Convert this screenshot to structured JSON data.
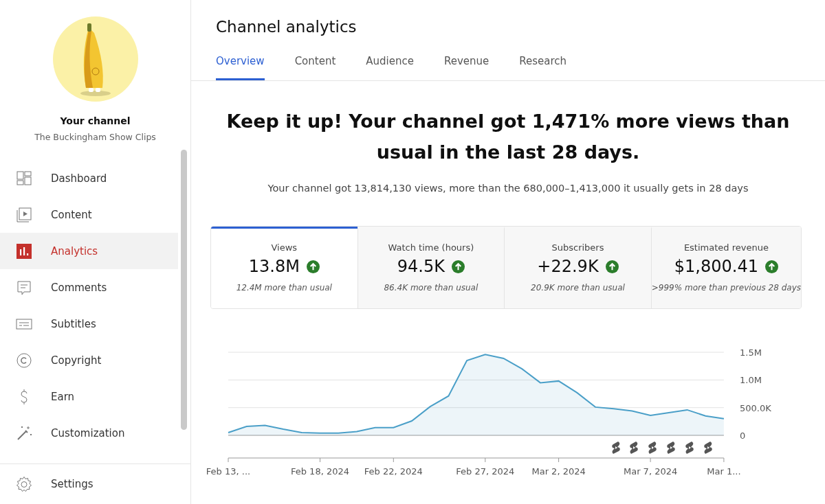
{
  "sidebar": {
    "channel_title": "Your channel",
    "channel_name": "The Buckingham Show Clips",
    "items": [
      {
        "label": "Dashboard",
        "selected": false
      },
      {
        "label": "Content",
        "selected": false
      },
      {
        "label": "Analytics",
        "selected": true
      },
      {
        "label": "Comments",
        "selected": false
      },
      {
        "label": "Subtitles",
        "selected": false
      },
      {
        "label": "Copyright",
        "selected": false
      },
      {
        "label": "Earn",
        "selected": false
      },
      {
        "label": "Customization",
        "selected": false
      }
    ],
    "footer_item": {
      "label": "Settings"
    }
  },
  "page": {
    "title": "Channel analytics",
    "tabs": [
      {
        "label": "Overview",
        "selected": true
      },
      {
        "label": "Content",
        "selected": false
      },
      {
        "label": "Audience",
        "selected": false
      },
      {
        "label": "Revenue",
        "selected": false
      },
      {
        "label": "Research",
        "selected": false
      }
    ],
    "headline": "Keep it up! Your channel got 1,471% more views than usual in the last 28 days.",
    "subtext": "Your channel got 13,814,130 views, more than the 680,000–1,413,000 it usually gets in 28 days",
    "metrics": [
      {
        "label": "Views",
        "value": "13.8M",
        "note": "12.4M more than usual",
        "selected": true
      },
      {
        "label": "Watch time (hours)",
        "value": "94.5K",
        "note": "86.4K more than usual",
        "selected": false
      },
      {
        "label": "Subscribers",
        "value": "+22.9K",
        "note": "20.9K more than usual",
        "selected": false
      },
      {
        "label": "Estimated revenue",
        "value": "$1,800.41",
        "note": ">999% more than previous 28 days",
        "selected": false
      }
    ],
    "chart_data": {
      "type": "area",
      "categories": [
        "Feb 13, ...",
        null,
        null,
        null,
        null,
        "Feb 18, 2024",
        null,
        null,
        null,
        "Feb 22, 2024",
        null,
        null,
        null,
        null,
        "Feb 27, 2024",
        null,
        null,
        null,
        "Mar 2, 2024",
        null,
        null,
        null,
        null,
        "Mar 7, 2024",
        null,
        null,
        null,
        "Mar 1..."
      ],
      "series": [
        {
          "color": "#4a9fc8",
          "values": [
            50000,
            160000,
            180000,
            110000,
            50000,
            40000,
            40000,
            70000,
            140000,
            140000,
            260000,
            520000,
            710000,
            1350000,
            1460000,
            1390000,
            1200000,
            950000,
            980000,
            770000,
            510000,
            480000,
            440000,
            360000,
            410000,
            460000,
            350000,
            300000
          ]
        }
      ],
      "yticks": [
        {
          "value": 0,
          "label": "0"
        },
        {
          "value": 500000,
          "label": "500.0K"
        },
        {
          "value": 1000000,
          "label": "1.0M"
        },
        {
          "value": 1500000,
          "label": "1.5M"
        }
      ],
      "ylim": [
        0,
        1500000
      ]
    }
  }
}
